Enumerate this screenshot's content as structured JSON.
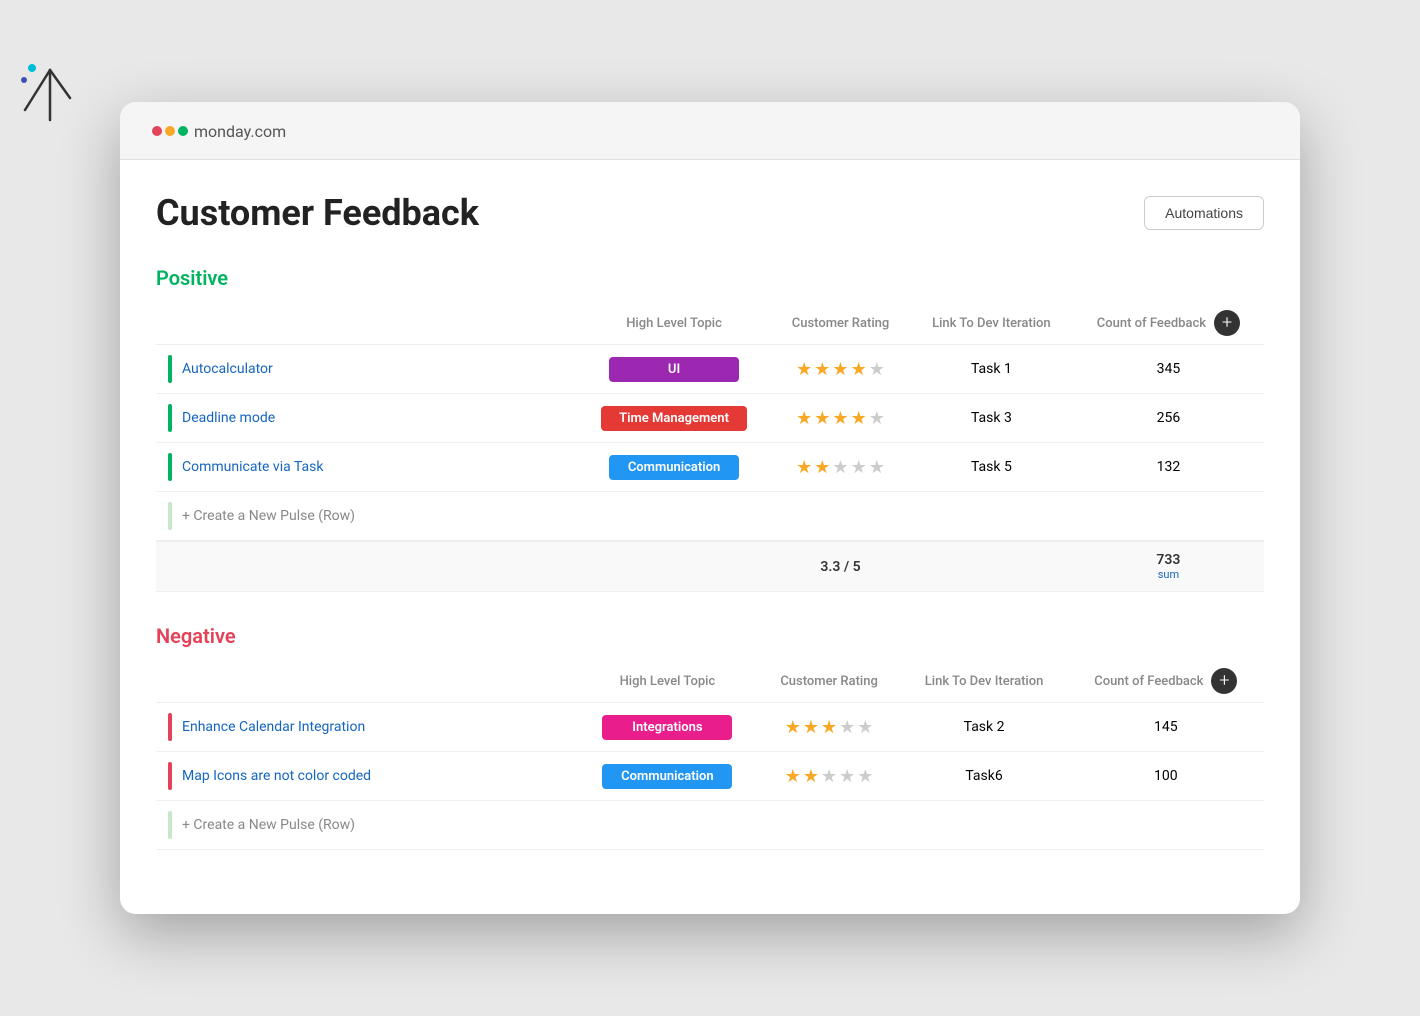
{
  "background": {
    "circle_color": "#00c875"
  },
  "header": {
    "logo_text": "monday",
    "logo_suffix": ".com"
  },
  "page": {
    "title": "Customer Feedback",
    "automations_label": "Automations"
  },
  "positive_section": {
    "title": "Positive",
    "columns": {
      "name": "",
      "high_level_topic": "High Level Topic",
      "customer_rating": "Customer Rating",
      "link_to_dev": "Link To Dev Iteration",
      "count_of_feedback": "Count of Feedback"
    },
    "rows": [
      {
        "name": "Autocalculator",
        "topic": "UI",
        "topic_color": "purple",
        "stars_filled": 4,
        "stars_total": 5,
        "link": "Task 1",
        "count": "345"
      },
      {
        "name": "Deadline mode",
        "topic": "Time Management",
        "topic_color": "red",
        "stars_filled": 4,
        "stars_total": 5,
        "link": "Task 3",
        "count": "256"
      },
      {
        "name": "Communicate via Task",
        "topic": "Communication",
        "topic_color": "blue",
        "stars_filled": 2,
        "stars_total": 5,
        "link": "Task 5",
        "count": "132"
      }
    ],
    "create_new_label": "+ Create a New Pulse (Row)",
    "summary": {
      "rating": "3.3 / 5",
      "count": "733",
      "count_label": "sum"
    }
  },
  "negative_section": {
    "title": "Negative",
    "columns": {
      "name": "",
      "high_level_topic": "High Level Topic",
      "customer_rating": "Customer Rating",
      "link_to_dev": "Link To Dev Iteration",
      "count_of_feedback": "Count of Feedback"
    },
    "rows": [
      {
        "name": "Enhance Calendar Integration",
        "topic": "Integrations",
        "topic_color": "pink",
        "stars_filled": 3,
        "stars_total": 5,
        "link": "Task 2",
        "count": "145"
      },
      {
        "name": "Map Icons are not color coded",
        "topic": "Communication",
        "topic_color": "blue",
        "stars_filled": 2,
        "stars_total": 5,
        "link": "Task6",
        "count": "100"
      }
    ],
    "create_new_label": "+ Create a New Pulse (Row)"
  }
}
